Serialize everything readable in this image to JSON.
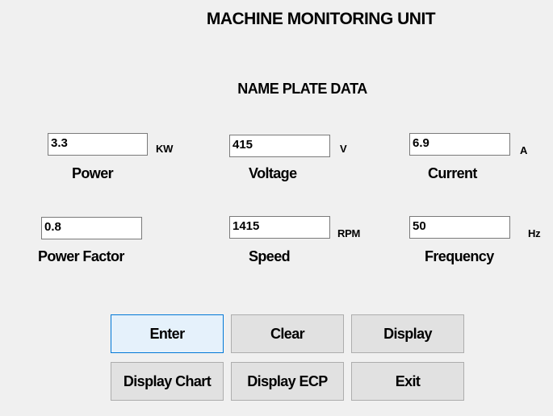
{
  "header": {
    "title": "MACHINE MONITORING UNIT",
    "subtitle": "NAME PLATE DATA"
  },
  "fields": {
    "power": {
      "value": "3.3",
      "unit": "KW",
      "label": "Power"
    },
    "voltage": {
      "value": "415",
      "unit": "V",
      "label": "Voltage"
    },
    "current": {
      "value": "6.9",
      "unit": "A",
      "label": "Current"
    },
    "power_factor": {
      "value": "0.8",
      "unit": "",
      "label": "Power Factor"
    },
    "speed": {
      "value": "1415",
      "unit": "RPM",
      "label": "Speed"
    },
    "frequency": {
      "value": "50",
      "unit": "Hz",
      "label": "Frequency"
    }
  },
  "buttons": {
    "enter": "Enter",
    "clear": "Clear",
    "display": "Display",
    "display_chart": "Display Chart",
    "display_ecp": "Display ECP",
    "exit": "Exit"
  },
  "colors": {
    "window_bg": "#f0f0f0",
    "button_bg": "#e1e1e1",
    "focus_border": "#0078d7"
  }
}
